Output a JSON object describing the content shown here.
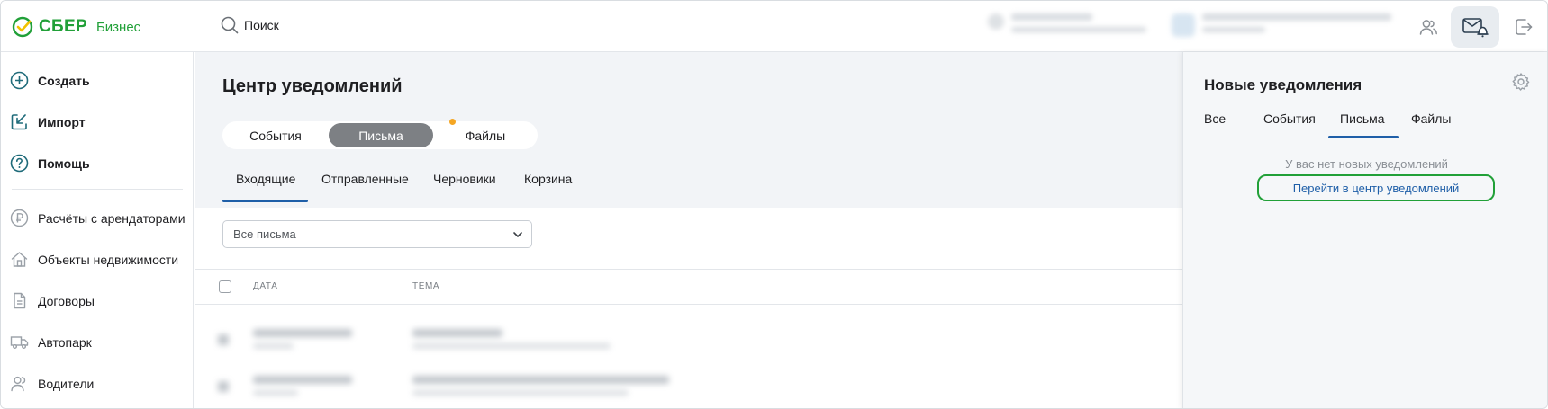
{
  "header": {
    "logo_main": "СБЕР",
    "logo_sub": "Бизнес",
    "search_label": "Поиск",
    "icons": [
      "search-icon",
      "users-icon",
      "notifications-mail-icon",
      "logout-icon"
    ],
    "accent_color": "#21a038"
  },
  "sidebar": {
    "primary": [
      {
        "label": "Создать",
        "icon": "plus-circle-icon"
      },
      {
        "label": "Импорт",
        "icon": "import-icon"
      },
      {
        "label": "Помощь",
        "icon": "help-icon"
      }
    ],
    "secondary": [
      {
        "label": "Расчёты с арендаторами",
        "icon": "ruble-icon"
      },
      {
        "label": "Объекты недвижимости",
        "icon": "house-icon"
      },
      {
        "label": "Договоры",
        "icon": "document-icon"
      },
      {
        "label": "Автопарк",
        "icon": "truck-icon"
      },
      {
        "label": "Водители",
        "icon": "drivers-icon"
      }
    ]
  },
  "main": {
    "title": "Центр уведомлений",
    "segments": [
      "События",
      "Письма",
      "Файлы"
    ],
    "active_segment": "Письма",
    "mail_tabs": [
      "Входящие",
      "Отправленные",
      "Черновики",
      "Корзина"
    ],
    "active_mail_tab": "Входящие",
    "filter": {
      "value": "Все письма"
    },
    "table": {
      "columns": [
        "ДАТА",
        "ТЕМА"
      ]
    }
  },
  "panel": {
    "title": "Новые уведомления",
    "tabs": [
      "Все",
      "События",
      "Письма",
      "Файлы"
    ],
    "active_tab": "Письма",
    "empty_text": "У вас нет новых уведомлений",
    "link_text": "Перейти в центр уведомлений",
    "link_color": "#1f5fa8",
    "highlight_color": "#21a038"
  }
}
